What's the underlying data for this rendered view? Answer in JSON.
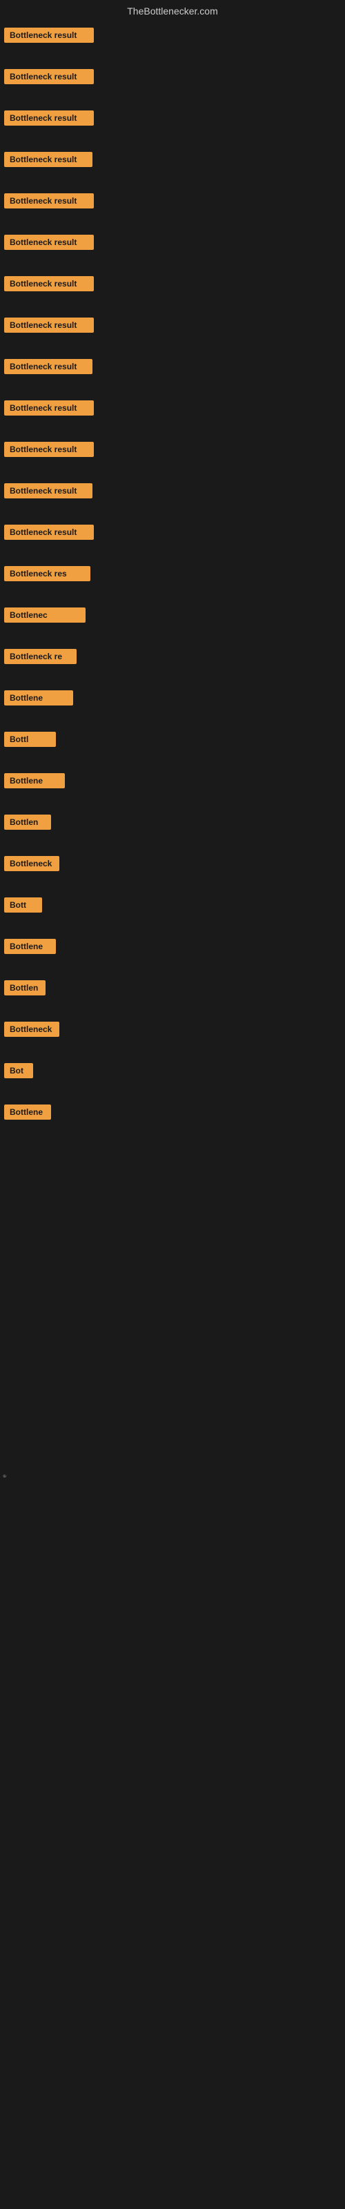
{
  "header": {
    "title": "TheBottlenecker.com"
  },
  "items": [
    {
      "id": 0,
      "label": "Bottleneck result"
    },
    {
      "id": 1,
      "label": "Bottleneck result"
    },
    {
      "id": 2,
      "label": "Bottleneck result"
    },
    {
      "id": 3,
      "label": "Bottleneck result"
    },
    {
      "id": 4,
      "label": "Bottleneck result"
    },
    {
      "id": 5,
      "label": "Bottleneck result"
    },
    {
      "id": 6,
      "label": "Bottleneck result"
    },
    {
      "id": 7,
      "label": "Bottleneck result"
    },
    {
      "id": 8,
      "label": "Bottleneck result"
    },
    {
      "id": 9,
      "label": "Bottleneck result"
    },
    {
      "id": 10,
      "label": "Bottleneck result"
    },
    {
      "id": 11,
      "label": "Bottleneck result"
    },
    {
      "id": 12,
      "label": "Bottleneck result"
    },
    {
      "id": 13,
      "label": "Bottleneck res"
    },
    {
      "id": 14,
      "label": "Bottlenec"
    },
    {
      "id": 15,
      "label": "Bottleneck re"
    },
    {
      "id": 16,
      "label": "Bottlene"
    },
    {
      "id": 17,
      "label": "Bottl"
    },
    {
      "id": 18,
      "label": "Bottlene"
    },
    {
      "id": 19,
      "label": "Bottlen"
    },
    {
      "id": 20,
      "label": "Bottleneck"
    },
    {
      "id": 21,
      "label": "Bott"
    },
    {
      "id": 22,
      "label": "Bottlene"
    },
    {
      "id": 23,
      "label": "Bottlen"
    },
    {
      "id": 24,
      "label": "Bottleneck"
    },
    {
      "id": 25,
      "label": "Bot"
    },
    {
      "id": 26,
      "label": "Bottlene"
    }
  ],
  "tiny_text": "e"
}
